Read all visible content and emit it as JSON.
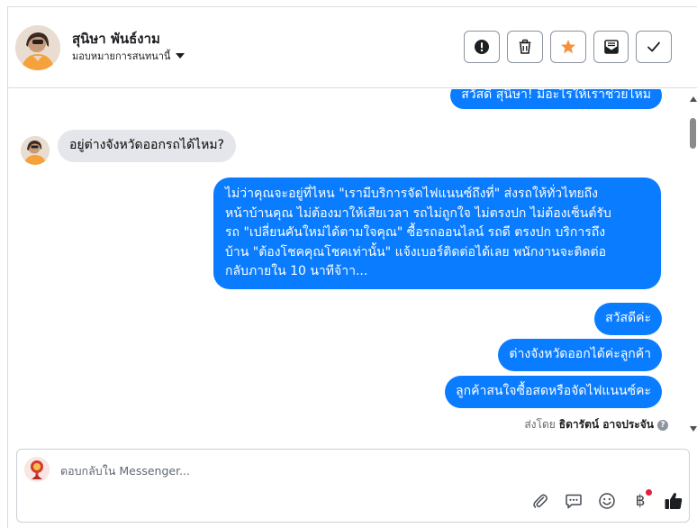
{
  "header": {
    "contact_name": "สุนิษา พันธ์งาม",
    "assign_label": "มอบหมายการสนทนานี้"
  },
  "actions": [
    "mark-spam",
    "delete",
    "star",
    "mark-unread",
    "mark-done"
  ],
  "thread": {
    "messages": [
      {
        "dir": "out",
        "text": "สวัสดี สุนิษา! มีอะไรให้เราช่วยไหม"
      },
      {
        "dir": "in",
        "text": "อยู่ต่างจังหวัดออกรถได้ไหม?"
      },
      {
        "dir": "out",
        "lines": [
          "ไม่ว่าคุณจะอยู่ที่ไหน \"เรามีบริการจัดไฟแนนซ์ถึงที่\"  ส่งรถให้ทั่วไทยถึง",
          "หน้าบ้านคุณ ไม่ต้องมาให้เสียเวลา รถไม่ถูกใจ ไม่ตรงปก ไม่ต้องเซ็นต์รับ",
          "รถ \"เปลี่ยนคันใหม่ได้ตามใจคุณ\" ซื้อรถออนไลน์ รถดี ตรงปก บริการถึง",
          "บ้าน \"ต้องโชคคุณโชคเท่านั้น\" แจ้งเบอร์ติดต่อได้เลย พนักงานจะติดต่อ",
          "กลับภายใน 10 นาทีจ้าา..."
        ]
      },
      {
        "dir": "out",
        "text": "สวัสดีค่ะ"
      },
      {
        "dir": "out",
        "text": "ต่างจังหวัดออกได้ค่ะลูกค้า"
      },
      {
        "dir": "out",
        "text": "ลูกค้าสนใจซื้อสดหรือจัดไฟแนนซ์คะ"
      }
    ],
    "sent_by_prefix": "ส่งโดย",
    "sent_by_name": "ธิดารัตน์ อาจประจัน"
  },
  "composer": {
    "placeholder": "ตอบกลับใน Messenger...",
    "value": "",
    "baht_symbol": "฿"
  },
  "colors": {
    "outgoing_bubble": "#0a7cff",
    "incoming_bubble": "#e4e6eb",
    "star": "#f7923b",
    "like": "#1c1e21"
  }
}
